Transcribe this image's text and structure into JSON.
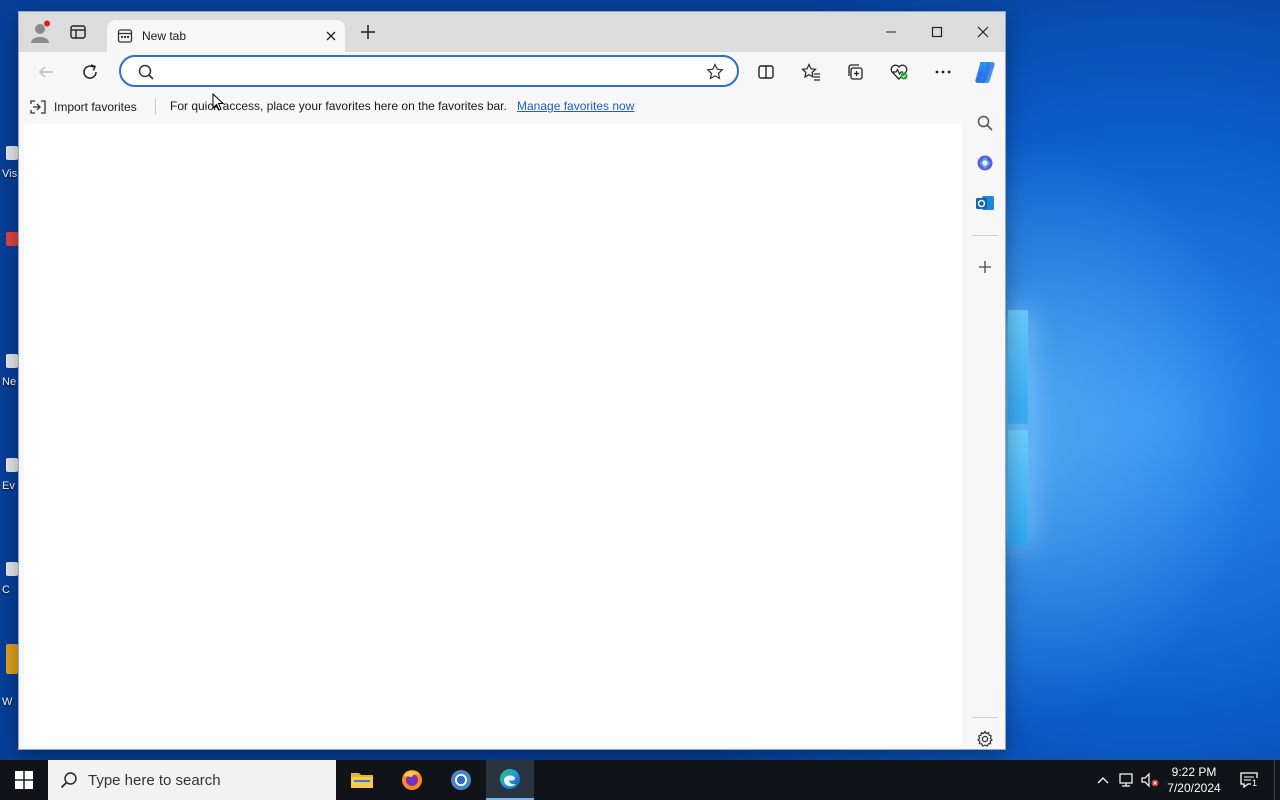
{
  "desktop": {
    "icons": [
      {
        "label": "Vis"
      },
      {
        "label": ""
      },
      {
        "label": "Ne"
      },
      {
        "label": "Ev"
      },
      {
        "label": "C"
      },
      {
        "label": "W"
      }
    ]
  },
  "browser": {
    "tab": {
      "title": "New tab",
      "favicon": "new-tab-page-icon"
    },
    "address_bar": {
      "value": "",
      "placeholder": ""
    },
    "favorites_bar": {
      "import_label": "Import favorites",
      "message": "For quick access, place your favorites here on the favorites bar.",
      "link_label": "Manage favorites now"
    },
    "icons": {
      "profile": "profile-icon",
      "tab_actions": "tab-actions-icon",
      "new_tab": "plus-icon",
      "minimize": "minimize-icon",
      "maximize": "maximize-icon",
      "close": "close-icon",
      "back": "back-arrow-icon",
      "refresh": "refresh-icon",
      "search": "search-icon",
      "favorite_star": "star-icon",
      "split_screen": "split-screen-icon",
      "favorites": "favorites-icon",
      "collections": "collections-icon",
      "browser_essentials": "heart-pulse-icon",
      "more": "more-icon",
      "copilot": "copilot-icon"
    },
    "sidebar": [
      "search-icon",
      "copilot-app-icon",
      "outlook-icon",
      "plus-icon",
      "gear-icon"
    ]
  },
  "taskbar": {
    "search_placeholder": "Type here to search",
    "apps": [
      "file-explorer-icon",
      "firefox-icon",
      "chrome-icon",
      "edge-icon"
    ],
    "clock": {
      "time": "9:22 PM",
      "date": "7/20/2024"
    },
    "notification_count": "1"
  },
  "colors": {
    "accent": "#2c6fd1",
    "link": "#1f5fbf",
    "taskbar": "#101418",
    "titlebar": "#dcdcdc"
  }
}
